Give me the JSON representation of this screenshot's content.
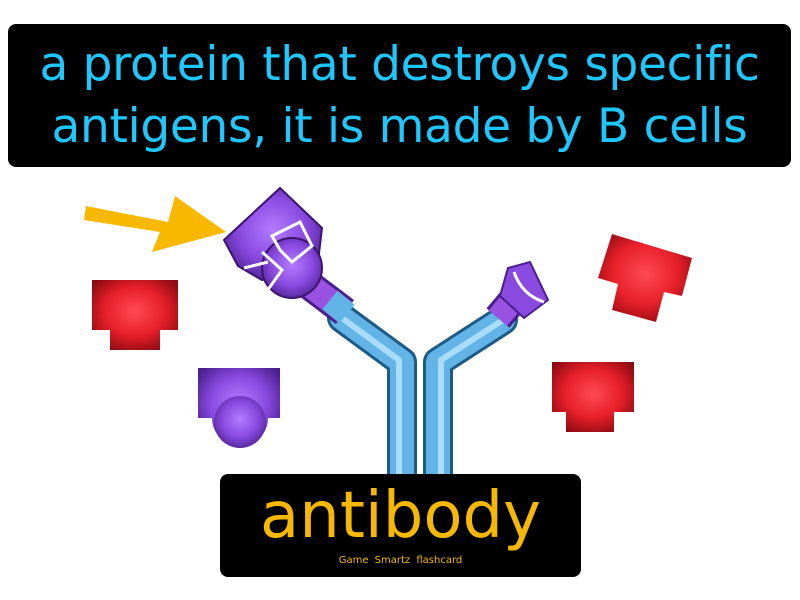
{
  "definition": {
    "line1": "a protein that destroys specific",
    "line2": "antigens, it is made by B cells"
  },
  "term": {
    "word": "antibody",
    "brand": "Game Smartz flashcard"
  },
  "colors": {
    "definition_text": "#1ec8ff",
    "term_text": "#f6b800",
    "antibody_stem": "#62b4e6",
    "antibody_tip": "#9a52e2",
    "antigen_red": "#e8202a",
    "antigen_purple": "#8a4ae0",
    "arrow": "#f8b800"
  },
  "icons": [
    "arrow-icon",
    "antibody-icon",
    "red-antigen-icon",
    "purple-antigen-icon"
  ]
}
